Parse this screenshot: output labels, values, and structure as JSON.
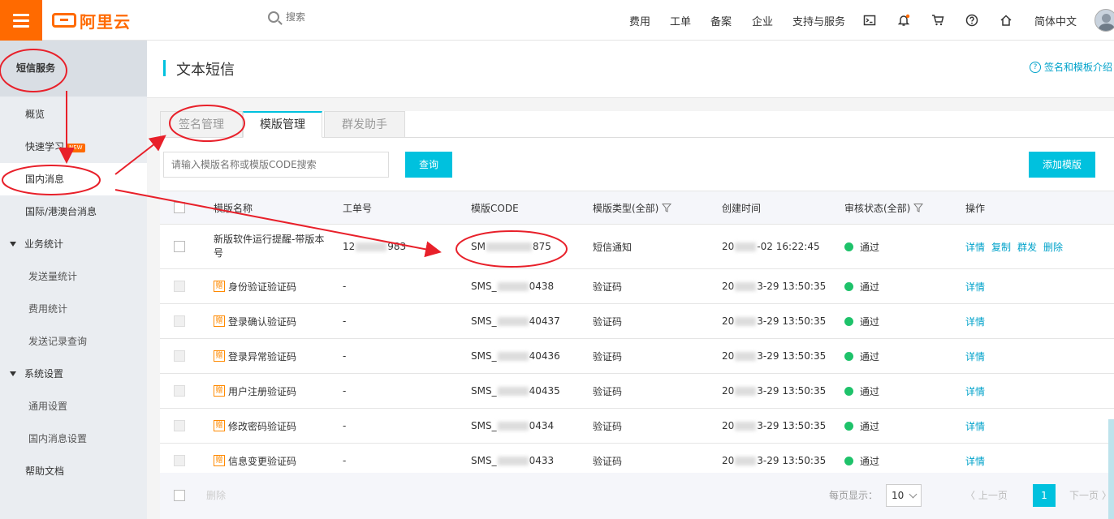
{
  "header": {
    "logo_text": "阿里云",
    "search_placeholder": "搜索",
    "nav": [
      "费用",
      "工单",
      "备案",
      "企业",
      "支持与服务"
    ],
    "language": "简体中文",
    "icons": [
      "terminal-icon",
      "bell-icon",
      "cart-icon",
      "help-icon",
      "home-icon"
    ]
  },
  "sidebar": {
    "title": "短信服务",
    "items": [
      {
        "label": "概览"
      },
      {
        "label": "快速学习",
        "badge": "NEW"
      },
      {
        "label": "国内消息"
      },
      {
        "label": "国际/港澳台消息"
      }
    ],
    "groups": [
      {
        "label": "业务统计",
        "children": [
          "发送量统计",
          "费用统计",
          "发送记录查询"
        ]
      },
      {
        "label": "系统设置",
        "children": [
          "通用设置",
          "国内消息设置"
        ]
      }
    ],
    "footer_item": "帮助文档"
  },
  "page": {
    "title": "文本短信",
    "help_link": "签名和模板介绍"
  },
  "tabs": [
    "签名管理",
    "模版管理",
    "群发助手"
  ],
  "toolbar": {
    "search_placeholder": "请输入模版名称或模版CODE搜索",
    "query_button": "查询",
    "add_button": "添加模版"
  },
  "table": {
    "columns": [
      "模版名称",
      "工单号",
      "模版CODE",
      "模版类型(全部)",
      "创建时间",
      "审核状态(全部)",
      "操作"
    ],
    "rows": [
      {
        "name": "新版软件运行提醒-带版本号",
        "ticket_a": "12",
        "ticket_b": "983",
        "code_a": "SM",
        "code_b": "875",
        "type": "短信通知",
        "time_a": "20",
        "time_b": "-02 16:22:45",
        "status": "通过",
        "actions": [
          "详情",
          "复制",
          "群发",
          "删除"
        ],
        "gift": false
      },
      {
        "name": "身份验证验证码",
        "ticket_a": "-",
        "ticket_b": "",
        "code_a": "SMS_",
        "code_b": "0438",
        "type": "验证码",
        "time_a": "20",
        "time_b": "3-29 13:50:35",
        "status": "通过",
        "actions": [
          "详情"
        ],
        "gift": true
      },
      {
        "name": "登录确认验证码",
        "ticket_a": "-",
        "ticket_b": "",
        "code_a": "SMS_",
        "code_b": "40437",
        "type": "验证码",
        "time_a": "20",
        "time_b": "3-29 13:50:35",
        "status": "通过",
        "actions": [
          "详情"
        ],
        "gift": true
      },
      {
        "name": "登录异常验证码",
        "ticket_a": "-",
        "ticket_b": "",
        "code_a": "SMS_",
        "code_b": "40436",
        "type": "验证码",
        "time_a": "20",
        "time_b": "3-29 13:50:35",
        "status": "通过",
        "actions": [
          "详情"
        ],
        "gift": true
      },
      {
        "name": "用户注册验证码",
        "ticket_a": "-",
        "ticket_b": "",
        "code_a": "SMS_",
        "code_b": "40435",
        "type": "验证码",
        "time_a": "20",
        "time_b": "3-29 13:50:35",
        "status": "通过",
        "actions": [
          "详情"
        ],
        "gift": true
      },
      {
        "name": "修改密码验证码",
        "ticket_a": "-",
        "ticket_b": "",
        "code_a": "SMS_",
        "code_b": "0434",
        "type": "验证码",
        "time_a": "20",
        "time_b": "3-29 13:50:35",
        "status": "通过",
        "actions": [
          "详情"
        ],
        "gift": true
      },
      {
        "name": "信息变更验证码",
        "ticket_a": "-",
        "ticket_b": "",
        "code_a": "SMS_",
        "code_b": "0433",
        "type": "验证码",
        "time_a": "20",
        "time_b": "3-29 13:50:35",
        "status": "通过",
        "actions": [
          "详情"
        ],
        "gift": true
      }
    ],
    "gift_glyph": "赠"
  },
  "footer": {
    "delete_label": "删除",
    "page_size_label": "每页显示：",
    "page_size": "10",
    "prev": "上一页",
    "current_page": "1",
    "next": "下一页"
  },
  "colors": {
    "brand": "#ff6a00",
    "accent": "#00c1de",
    "link": "#00a2ca",
    "success": "#1ec26a",
    "annotation": "#e8202a"
  }
}
